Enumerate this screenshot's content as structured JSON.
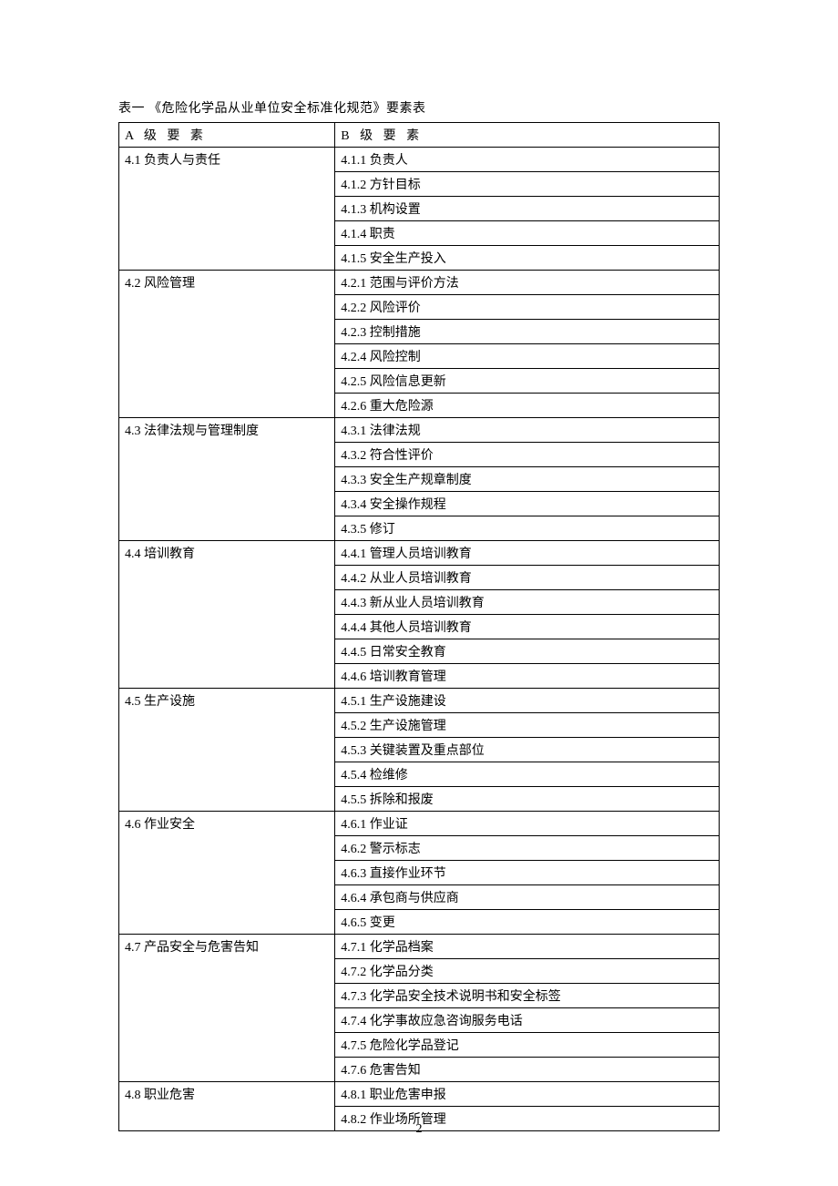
{
  "caption": "表一  《危险化学品从业单位安全标准化规范》要素表",
  "headerA": "A 级 要 素",
  "headerB": "B 级 要 素",
  "pageNumber": "2",
  "sections": [
    {
      "a": "4.1 负责人与责任",
      "b": [
        "4.1.1 负责人",
        "4.1.2 方针目标",
        "4.1.3 机构设置",
        "4.1.4 职责",
        "4.1.5 安全生产投入"
      ]
    },
    {
      "a": "4.2 风险管理",
      "b": [
        "4.2.1 范围与评价方法",
        "4.2.2 风险评价",
        "4.2.3 控制措施",
        "4.2.4 风险控制",
        "4.2.5 风险信息更新",
        "4.2.6 重大危险源"
      ]
    },
    {
      "a": "4.3 法律法规与管理制度",
      "b": [
        "4.3.1 法律法规",
        "4.3.2 符合性评价",
        "4.3.3 安全生产规章制度",
        "4.3.4 安全操作规程",
        "4.3.5 修订"
      ]
    },
    {
      "a": "4.4 培训教育",
      "b": [
        "4.4.1 管理人员培训教育",
        "4.4.2 从业人员培训教育",
        "4.4.3 新从业人员培训教育",
        "4.4.4 其他人员培训教育",
        "4.4.5 日常安全教育",
        "4.4.6 培训教育管理"
      ]
    },
    {
      "a": "4.5 生产设施",
      "b": [
        "4.5.1 生产设施建设",
        "4.5.2 生产设施管理",
        "4.5.3 关键装置及重点部位",
        "4.5.4 检维修",
        "4.5.5 拆除和报废"
      ]
    },
    {
      "a": "4.6 作业安全",
      "b": [
        "4.6.1 作业证",
        "4.6.2 警示标志",
        "4.6.3 直接作业环节",
        "4.6.4 承包商与供应商",
        "4.6.5 变更"
      ]
    },
    {
      "a": "4.7 产品安全与危害告知",
      "b": [
        "4.7.1 化学品档案",
        "4.7.2 化学品分类",
        "4.7.3 化学品安全技术说明书和安全标签",
        "4.7.4 化学事故应急咨询服务电话",
        "4.7.5 危险化学品登记",
        "4.7.6 危害告知"
      ]
    },
    {
      "a": "4.8 职业危害",
      "b": [
        "4.8.1 职业危害申报",
        "4.8.2 作业场所管理"
      ]
    }
  ]
}
